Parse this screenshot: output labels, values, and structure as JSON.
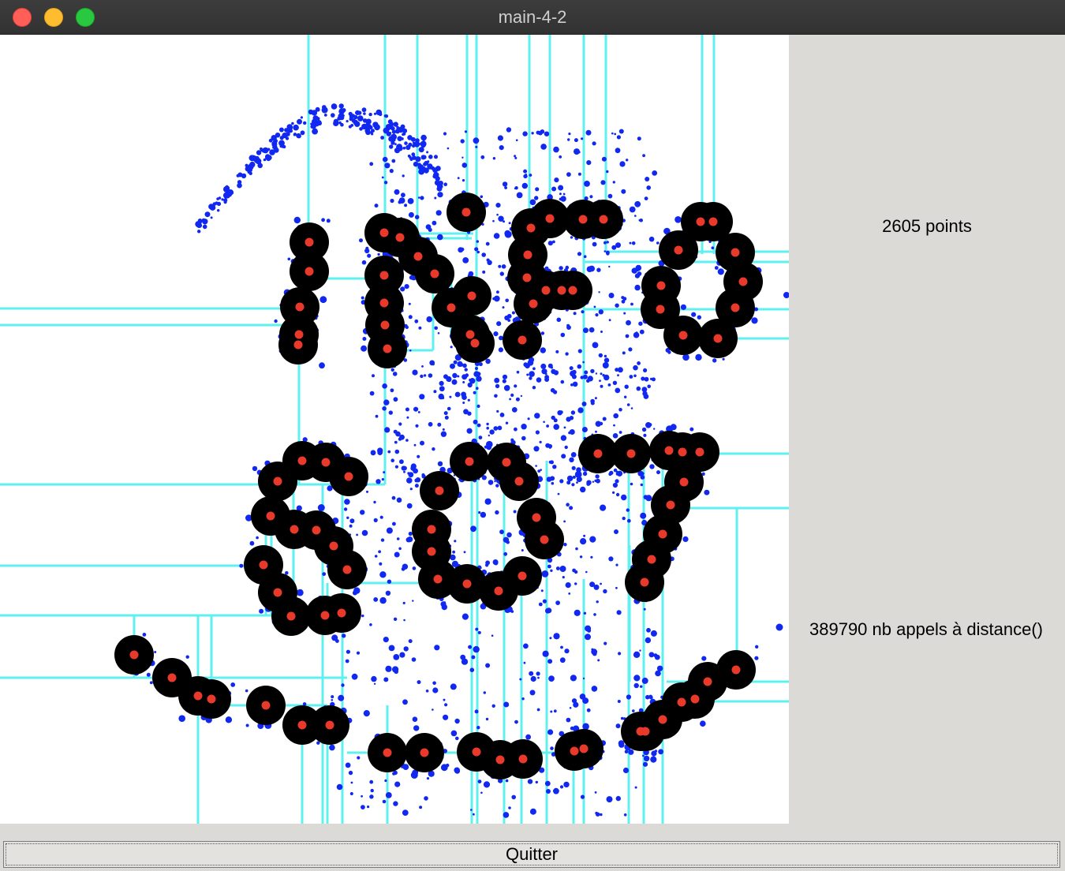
{
  "window": {
    "title": "main-4-2"
  },
  "stats": {
    "points_label": "2605 points",
    "calls_label": "389790 nb appels à distance()"
  },
  "buttons": {
    "quit_label": "Quitter"
  },
  "colors": {
    "canvas_bg": "#ffffff",
    "sample_points": "#1028f0",
    "centers": "#e8392a",
    "disks": "#000000",
    "kd_lines": "#5ff0f0",
    "panel_bg": "#dcdad6"
  },
  "visualization": {
    "description_key": "kd-tree partition with sampled points, disks and centers",
    "elements": [
      "sample-points",
      "disks",
      "centers",
      "kd-partition-lines"
    ]
  }
}
